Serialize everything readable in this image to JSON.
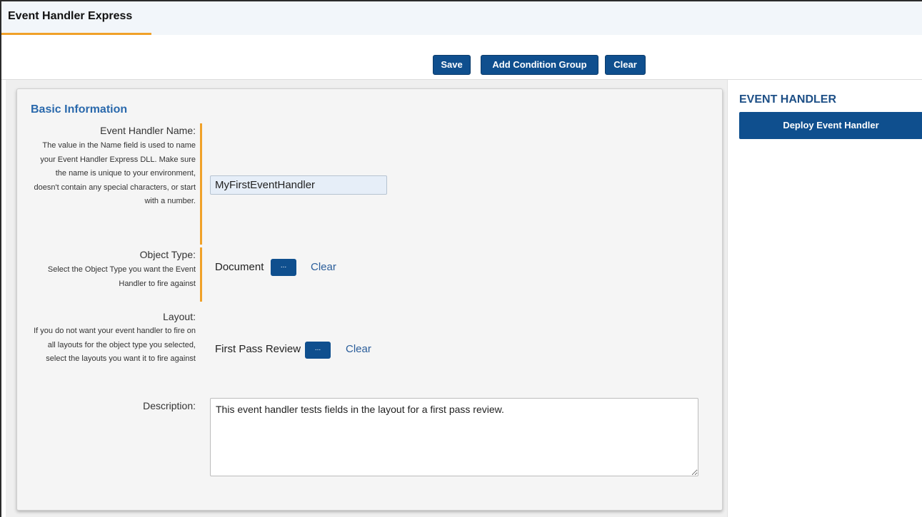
{
  "tab": {
    "label": "Event Handler Express"
  },
  "toolbar": {
    "save_label": "Save",
    "add_condition_group_label": "Add Condition Group",
    "clear_label": "Clear"
  },
  "basic_info": {
    "title": "Basic Information",
    "name": {
      "label": "Event Handler Name:",
      "help": "The value in the Name field is used to name your Event Handler Express DLL. Make sure the name is unique to your environment, doesn't contain any special characters, or start with a number.",
      "value": "MyFirstEventHandler"
    },
    "object_type": {
      "label": "Object Type:",
      "help": "Select the Object Type you want the Event Handler to fire against",
      "value": "Document",
      "browse_label": "...",
      "clear_label": "Clear"
    },
    "layout": {
      "label": "Layout:",
      "help": "If you do not want your event handler to fire on all layouts for the object type you selected, select the layouts you want it to fire against",
      "value": "First Pass Review",
      "browse_label": "...",
      "clear_label": "Clear"
    },
    "description": {
      "label": "Description:",
      "value": "This event handler tests fields in the layout for a first pass review."
    }
  },
  "sidebar": {
    "title": "EVENT HANDLER",
    "deploy_label": "Deploy Event Handler"
  },
  "colors": {
    "primary_button": "#0f4f8e",
    "accent_orange": "#f0a129",
    "link": "#2a5d9a",
    "section_title": "#2a69ac"
  }
}
